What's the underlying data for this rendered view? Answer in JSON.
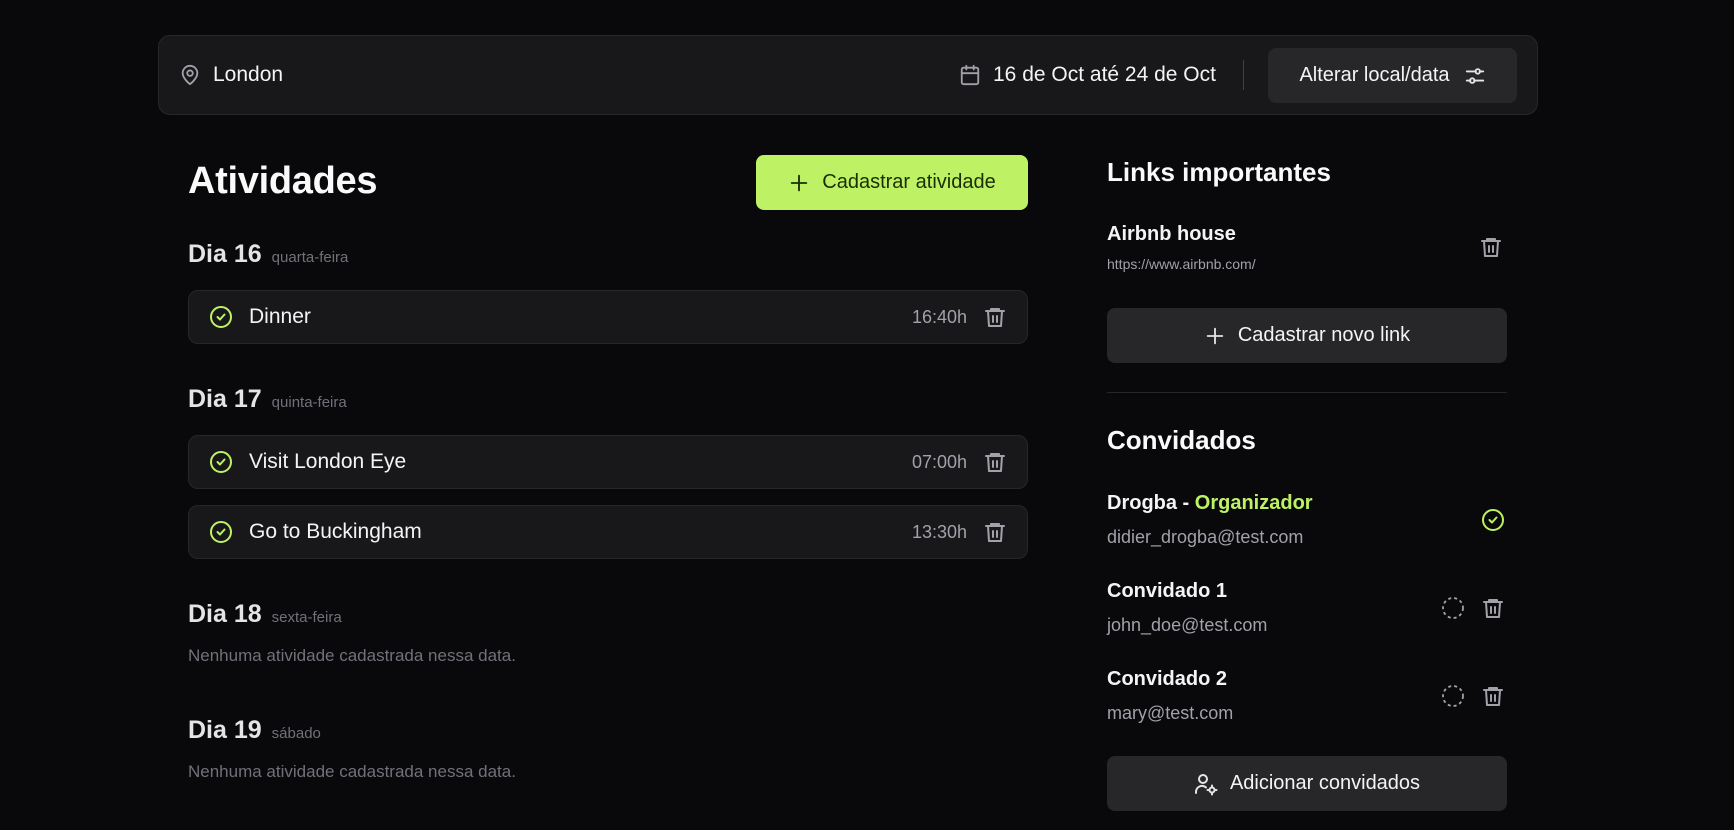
{
  "header": {
    "location": "London",
    "dates": "16 de Oct até 24 de Oct",
    "change_label": "Alterar local/data"
  },
  "activities": {
    "title": "Atividades",
    "add_label": "Cadastrar atividade",
    "empty_message": "Nenhuma atividade cadastrada nessa data.",
    "days": [
      {
        "day": "Dia 16",
        "weekday": "quarta-feira",
        "items": [
          {
            "title": "Dinner",
            "time": "16:40h"
          }
        ]
      },
      {
        "day": "Dia 17",
        "weekday": "quinta-feira",
        "items": [
          {
            "title": "Visit London Eye",
            "time": "07:00h"
          },
          {
            "title": "Go to Buckingham",
            "time": "13:30h"
          }
        ]
      },
      {
        "day": "Dia 18",
        "weekday": "sexta-feira",
        "items": []
      },
      {
        "day": "Dia 19",
        "weekday": "sábado",
        "items": []
      }
    ]
  },
  "links": {
    "title": "Links importantes",
    "items": [
      {
        "title": "Airbnb house",
        "url": "https://www.airbnb.com/"
      }
    ],
    "add_label": "Cadastrar novo link"
  },
  "guests": {
    "title": "Convidados",
    "organizer_label": "Organizador",
    "items": [
      {
        "name": "Drogba",
        "separator": " - ",
        "email": "didier_drogba@test.com",
        "confirmed": true,
        "organizer": true
      },
      {
        "name": "Convidado 1",
        "email": "john_doe@test.com",
        "confirmed": false
      },
      {
        "name": "Convidado 2",
        "email": "mary@test.com",
        "confirmed": false
      }
    ],
    "add_label": "Adicionar convidados"
  },
  "colors": {
    "accent": "#bef264",
    "background": "#09090b",
    "surface": "#18181b",
    "button": "#27272a"
  }
}
